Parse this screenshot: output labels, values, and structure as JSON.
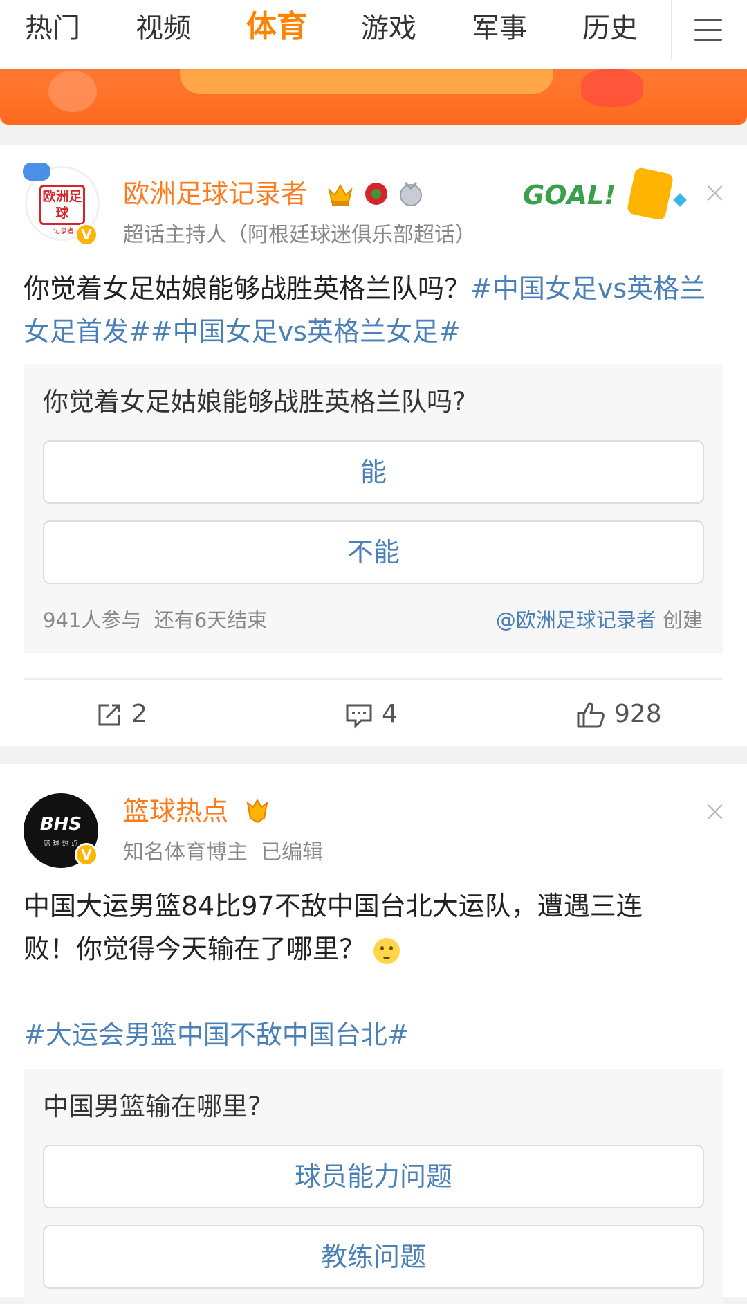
{
  "nav": {
    "tabs": [
      "热门",
      "视频",
      "体育",
      "游戏",
      "军事",
      "历史"
    ],
    "active_tab": "体育"
  },
  "posts": [
    {
      "username": "欧洲足球记录者",
      "subtitle": "超话主持人（阿根廷球迷俱乐部超话）",
      "avatar_text": "欧洲足球",
      "avatar_subtext": "记录者",
      "deco_text": "GOAL!",
      "text_plain": "你觉着女足姑娘能够战胜英格兰队吗？",
      "text_tag1": "#中国女足vs英格兰女足首发#",
      "text_tag2": "#中国女足vs英格兰女足#",
      "poll": {
        "question": "你觉着女足姑娘能够战胜英格兰队吗?",
        "options": [
          "能",
          "不能"
        ],
        "participants": "941人参与",
        "remaining": "还有6天结束",
        "creator_mention": "@欧洲足球记录者",
        "creator_suffix": "创建"
      },
      "actions": {
        "repost": "2",
        "comment": "4",
        "like": "928"
      }
    },
    {
      "username": "篮球热点",
      "subtitle_role": "知名体育博主",
      "subtitle_edit": "已编辑",
      "avatar_text": "BHS",
      "avatar_subtext": "篮 球 热 点",
      "text_line1": "中国大运男篮84比97不敌中国台北大运队，遭遇三连",
      "text_line2": "败！你觉得今天输在了哪里？",
      "text_tag": "#大运会男篮中国不敌中国台北#",
      "poll": {
        "question": "中国男篮输在哪里?",
        "options": [
          "球员能力问题",
          "教练问题"
        ]
      }
    }
  ],
  "colors": {
    "accent": "#ff8200",
    "link": "#4a7fb8",
    "username": "#ff7a1a"
  }
}
